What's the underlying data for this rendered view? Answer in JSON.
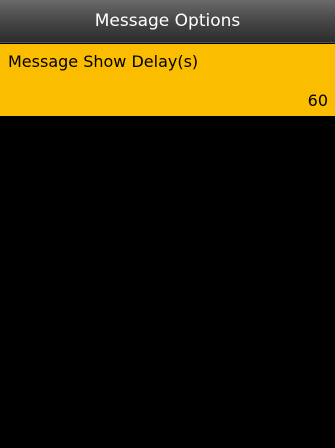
{
  "title_bar": {
    "title": "Message Options"
  },
  "menu": {
    "items": [
      {
        "label": "Message Show Delay(s)",
        "value": "60",
        "selected": true
      }
    ]
  },
  "colors": {
    "title_bar": "#4a4a4a",
    "selected_item": "#fbbd00",
    "background": "#000000"
  }
}
